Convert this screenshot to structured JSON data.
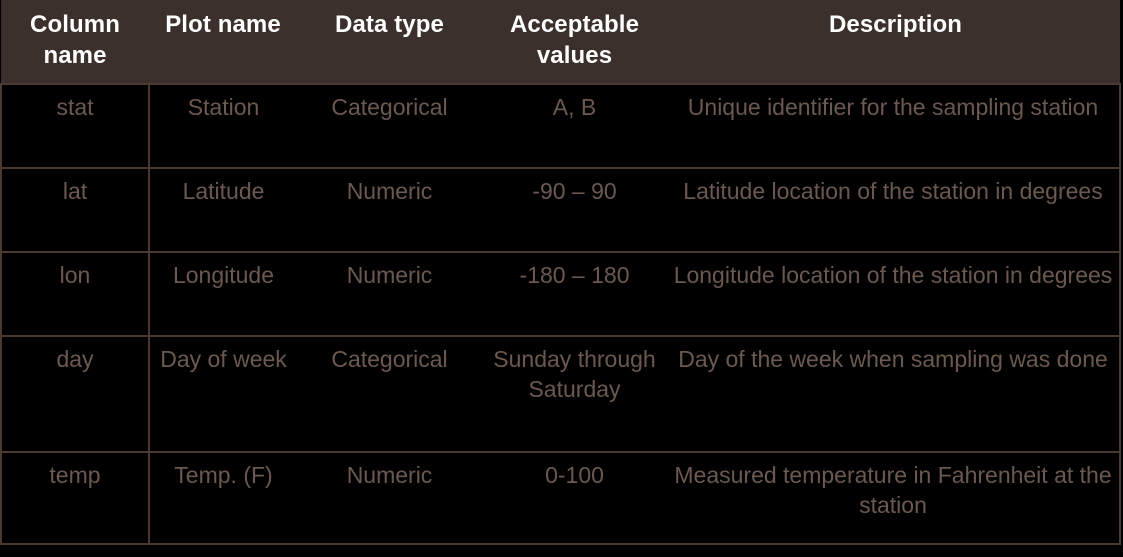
{
  "table": {
    "columns": [
      {
        "key": "column_name",
        "label": "Column\nname"
      },
      {
        "key": "plot_name",
        "label": "Plot\nname"
      },
      {
        "key": "data_type",
        "label": "Data type"
      },
      {
        "key": "acceptable_values",
        "label": "Acceptable\nvalues"
      },
      {
        "key": "description",
        "label": "Description"
      }
    ],
    "headers": {
      "column_name": "Column name",
      "plot_name": "Plot name",
      "data_type": "Data type",
      "acceptable_values": "Acceptable values",
      "description": "Description"
    },
    "rows": [
      {
        "column_name": "stat",
        "plot_name": "Station",
        "data_type": "Categorical",
        "acceptable_values": "A, B",
        "description": "Unique identifier for the sampling station"
      },
      {
        "column_name": "lat",
        "plot_name": "Latitude",
        "data_type": "Numeric",
        "acceptable_values": "-90 – 90",
        "description": "Latitude location of the station in degrees"
      },
      {
        "column_name": "lon",
        "plot_name": "Longitude",
        "data_type": "Numeric",
        "acceptable_values": "-180 – 180",
        "description": "Longitude location of the station in degrees"
      },
      {
        "column_name": "day",
        "plot_name": "Day of week",
        "data_type": "Categorical",
        "acceptable_values": "Sunday through Saturday",
        "description": "Day of the week when sampling was done"
      },
      {
        "column_name": "temp",
        "plot_name": "Temp. (F)",
        "data_type": "Numeric",
        "acceptable_values": "0-100",
        "description": "Measured temperature in Fahrenheit at the station"
      }
    ]
  },
  "colors": {
    "header_background": "#3b302b",
    "header_text": "#ffffff",
    "body_background": "#000000",
    "body_text": "#6b5951",
    "border": "#4b3a32"
  }
}
